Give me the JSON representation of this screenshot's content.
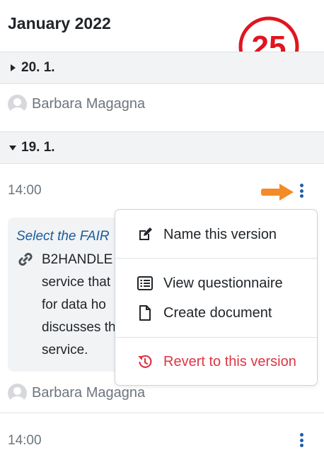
{
  "header": {
    "month": "January 2022"
  },
  "step_badge": {
    "number": "25",
    "color": "#e0151f"
  },
  "days": [
    {
      "label": "20. 1.",
      "expanded": false
    },
    {
      "label": "19. 1.",
      "expanded": true
    }
  ],
  "authors": {
    "first": "Barbara Magagna",
    "second": "Barbara Magagna",
    "third": "Barbara Magagna"
  },
  "versions": [
    {
      "time": "14:00"
    },
    {
      "time": "14:00"
    }
  ],
  "change_card": {
    "question": "Select the FAIR",
    "answer_lines": [
      "B2HANDLE",
      "service that",
      "for data ho",
      "discusses th",
      "service."
    ]
  },
  "menu": {
    "items": [
      {
        "label": "Name this version",
        "icon": "edit-icon"
      },
      {
        "label": "View questionnaire",
        "icon": "list-icon"
      },
      {
        "label": "Create document",
        "icon": "document-icon"
      },
      {
        "label": "Revert to this version",
        "icon": "history-icon"
      }
    ]
  },
  "colors": {
    "accent": "#1f5ea8",
    "danger": "#dc3545",
    "arrow": "#f28c28",
    "muted": "#6c757d"
  }
}
